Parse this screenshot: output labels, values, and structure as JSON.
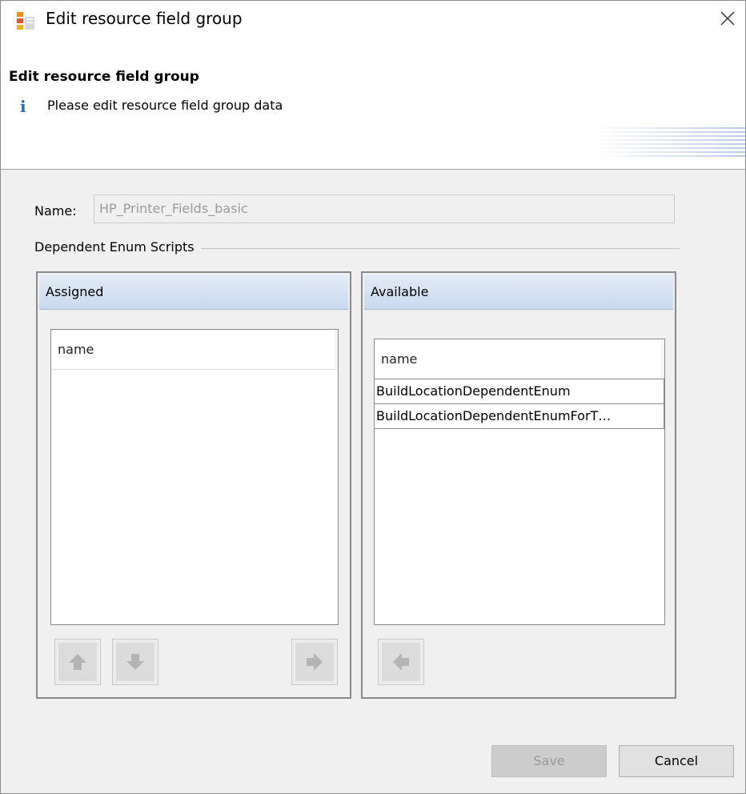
{
  "window": {
    "title": "Edit resource field group",
    "close_icon": "close-icon"
  },
  "banner": {
    "title": "Edit resource field group",
    "message": "Please edit resource field group data",
    "info_icon": "info-icon",
    "info_glyph": "i"
  },
  "form": {
    "name_label": "Name:",
    "name_value": "HP_Printer_Fields_basic",
    "group_label": "Dependent Enum Scripts"
  },
  "assigned": {
    "header": "Assigned",
    "column": "name",
    "rows": [],
    "buttons": [
      "move-up-icon",
      "move-down-icon",
      "move-right-icon"
    ]
  },
  "available": {
    "header": "Available",
    "column": "name",
    "rows": [
      "BuildLocationDependentEnum",
      "BuildLocationDependentEnumForT…"
    ],
    "buttons": [
      "move-left-icon"
    ]
  },
  "footer": {
    "save_label": "Save",
    "cancel_label": "Cancel"
  },
  "colors": {
    "header_gradient_top": "#e4ecf6",
    "header_gradient_bottom": "#c9d9ee",
    "info_blue": "#2a6ebb",
    "disabled_text": "#9a9a9a"
  }
}
